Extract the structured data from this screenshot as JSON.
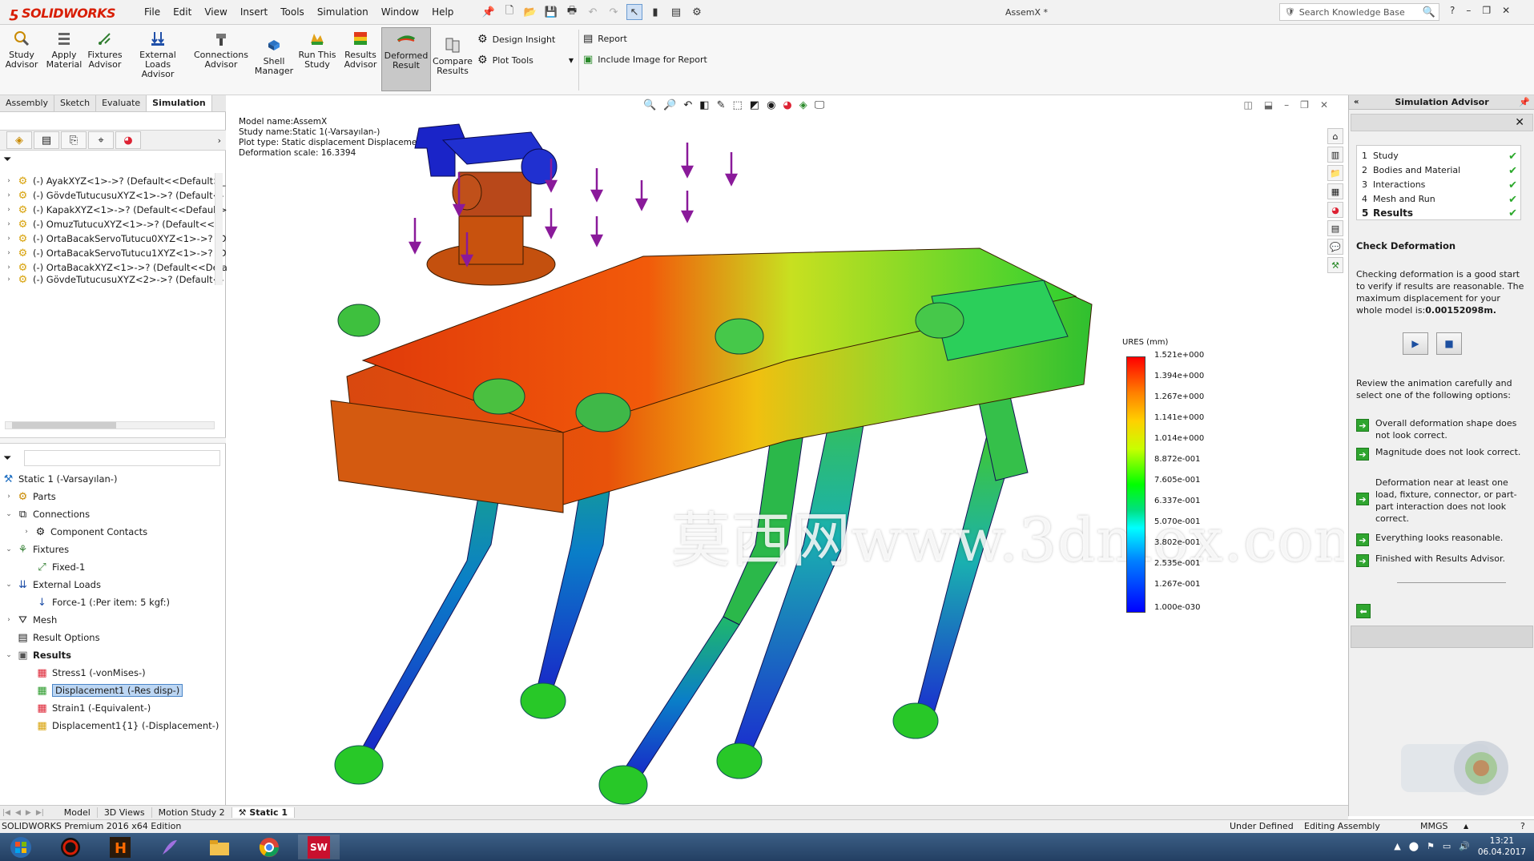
{
  "app": {
    "brand": "SOLIDWORKS",
    "document_title": "AssemX *"
  },
  "menu": [
    "File",
    "Edit",
    "View",
    "Insert",
    "Tools",
    "Simulation",
    "Window",
    "Help"
  ],
  "search": {
    "placeholder": "Search Knowledge Base"
  },
  "ribbon": {
    "buttons": [
      {
        "label": "Study\nAdvisor"
      },
      {
        "label": "Apply\nMaterial"
      },
      {
        "label": "Fixtures\nAdvisor"
      },
      {
        "label": "External Loads\nAdvisor"
      },
      {
        "label": "Connections\nAdvisor"
      },
      {
        "label": "Shell\nManager"
      },
      {
        "label": "Run This\nStudy"
      },
      {
        "label": "Results\nAdvisor"
      },
      {
        "label": "Deformed\nResult"
      },
      {
        "label": "Compare\nResults"
      }
    ],
    "design_insight": "Design Insight",
    "plot_tools": "Plot Tools",
    "report": "Report",
    "include_image": "Include Image for Report"
  },
  "cmd_tabs": [
    "Assembly",
    "Sketch",
    "Evaluate",
    "Simulation"
  ],
  "feature_tree": [
    "(-) AyakXYZ<1>->? (Default<<Default>_",
    "(-) GövdeTutucusuXYZ<1>->? (Default<-",
    "(-) KapakXYZ<1>->? (Default<<Default>",
    "(-) OmuzTutucuXYZ<1>->? (Default<<D",
    "(-) OrtaBacakServoTutucu0XYZ<1>->? (D",
    "(-) OrtaBacakServoTutucu1XYZ<1>->? (D",
    "(-) OrtaBacakXYZ<1>->? (Default<<Defa",
    "(-) GövdeTutucusuXYZ<2>->? (Default<-"
  ],
  "sim_tree": {
    "study": "Static 1 (-Varsayılan-)",
    "parts": "Parts",
    "connections": "Connections",
    "component_contacts": "Component Contacts",
    "fixtures": "Fixtures",
    "fixed1": "Fixed-1",
    "external_loads": "External Loads",
    "force1": "Force-1 (:Per item: 5 kgf:)",
    "mesh": "Mesh",
    "result_options": "Result Options",
    "results": "Results",
    "stress1": "Stress1 (-vonMises-)",
    "displacement1": "Displacement1 (-Res disp-)",
    "strain1": "Strain1 (-Equivalent-)",
    "displacement1_1": "Displacement1{1} (-Displacement-)"
  },
  "model_info": {
    "line1": "Model name:AssemX",
    "line2": "Study name:Static 1(-Varsayılan-)",
    "line3": "Plot type: Static displacement Displacement1",
    "line4": "Deformation scale: 16.3394"
  },
  "legend": {
    "title": "URES (mm)",
    "values": [
      "1.521e+000",
      "1.394e+000",
      "1.267e+000",
      "1.141e+000",
      "1.014e+000",
      "8.872e-001",
      "7.605e-001",
      "6.337e-001",
      "5.070e-001",
      "3.802e-001",
      "2.535e-001",
      "1.267e-001",
      "1.000e-030"
    ]
  },
  "watermark": "莫西网www.3dmox.com",
  "advisor": {
    "title": "Simulation Advisor",
    "steps": [
      {
        "num": "1",
        "label": "Study"
      },
      {
        "num": "2",
        "label": "Bodies and Material"
      },
      {
        "num": "3",
        "label": "Interactions"
      },
      {
        "num": "4",
        "label": "Mesh and Run"
      },
      {
        "num": "5",
        "label": "Results"
      }
    ],
    "check_heading": "Check Deformation",
    "check_text": "Checking deformation is a good start to verify if results are reasonable. The maximum displacement for your whole model is:",
    "max_disp": "0.00152098m.",
    "review_text": "Review the animation carefully and select one of the following options:",
    "options": [
      "Overall deformation shape does not look correct.",
      "Magnitude does not look correct.",
      "Deformation near at least one load, fixture, connector, or part-part interaction does not look correct.",
      "Everything looks reasonable.",
      "Finished with Results Advisor."
    ]
  },
  "bottom_tabs": [
    "Model",
    "3D Views",
    "Motion Study 2",
    "Static 1"
  ],
  "status": {
    "edition": "SOLIDWORKS Premium 2016 x64 Edition",
    "state": "Under Defined",
    "mode": "Editing Assembly",
    "units": "MMGS"
  },
  "clock": {
    "time": "13:21",
    "date": "06.04.2017"
  }
}
